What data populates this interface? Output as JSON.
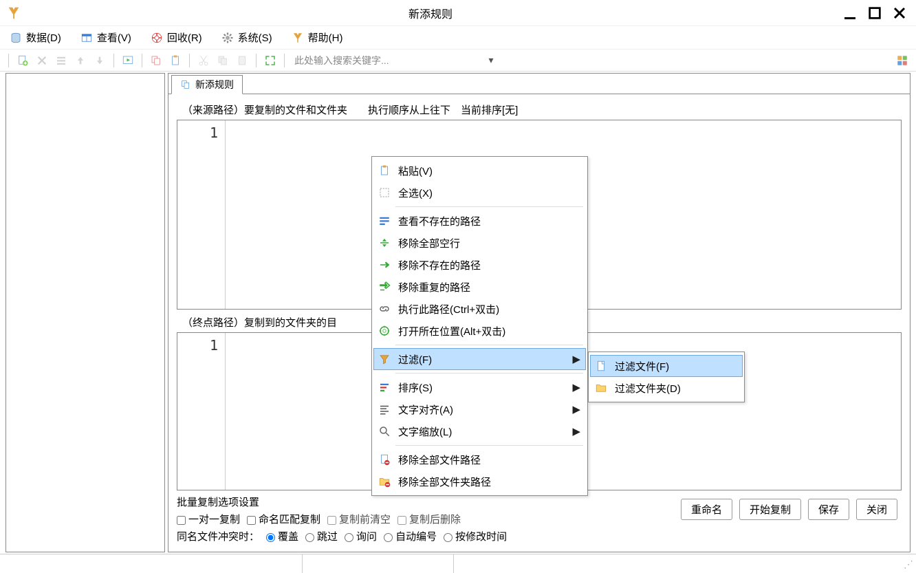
{
  "title": "新添规则",
  "menu": {
    "data": "数据(D)",
    "view": "查看(V)",
    "recycle": "回收(R)",
    "system": "系统(S)",
    "help": "帮助(H)"
  },
  "search_placeholder": "此处输入搜索关键字...",
  "tab_label": "新添规则",
  "src_label": "（来源路径）要复制的文件和文件夹　　执行顺序从上往下　当前排序[无]",
  "dst_label": "（终点路径）复制到的文件夹的目",
  "dst_label_cutoff_char": "]",
  "gutter_1": "1",
  "options": {
    "title": "批量复制选项设置",
    "one_to_one": "一对一复制",
    "name_match": "命名匹配复制",
    "clear_before_partial": "复制前清空",
    "delete_after_partial": "复制后删除",
    "conflict_label": "同名文件冲突时：",
    "overwrite": "覆盖",
    "skip": "跳过",
    "ask": "询问",
    "autonum": "自动编号",
    "by_mtime": "按修改时间"
  },
  "buttons": {
    "rename": "重命名",
    "start_copy": "开始复制",
    "save": "保存",
    "close": "关闭"
  },
  "ctx": {
    "paste": "粘贴(V)",
    "select_all": "全选(X)",
    "view_nonexist": "查看不存在的路径",
    "remove_empty": "移除全部空行",
    "remove_nonexist": "移除不存在的路径",
    "remove_dup": "移除重复的路径",
    "exec_path": "执行此路径(Ctrl+双击)",
    "open_loc": "打开所在位置(Alt+双击)",
    "filter": "过滤(F)",
    "sort": "排序(S)",
    "align": "文字对齐(A)",
    "zoom": "文字缩放(L)",
    "remove_file_paths": "移除全部文件路径",
    "remove_folder_paths": "移除全部文件夹路径",
    "filter_files": "过滤文件(F)",
    "filter_folders": "过滤文件夹(D)"
  }
}
